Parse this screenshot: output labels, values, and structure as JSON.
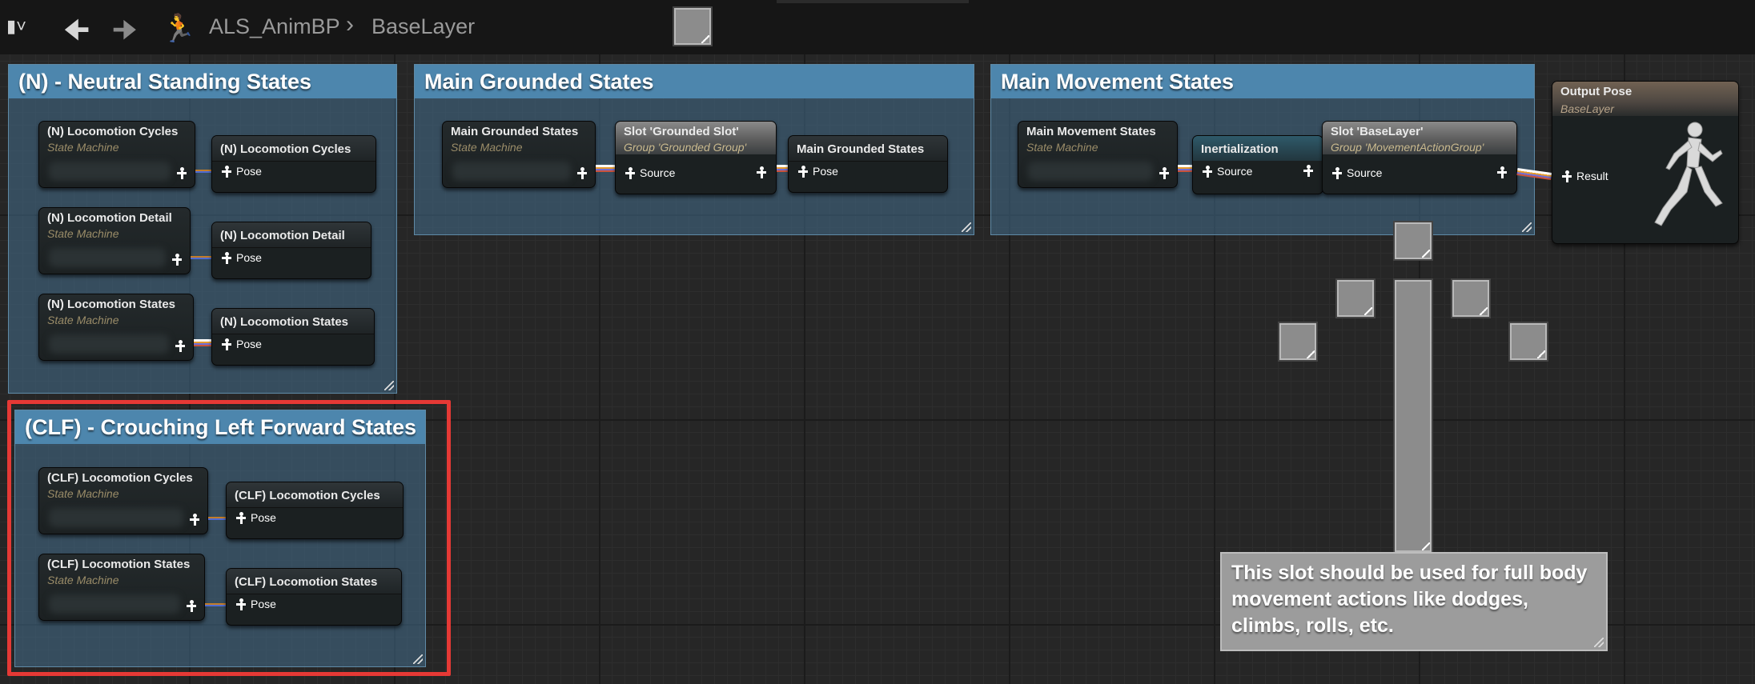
{
  "breadcrumb": {
    "graph": "ALS_AnimBP",
    "layer": "BaseLayer"
  },
  "icons": {
    "bookmark": "bookmark-icon",
    "back": "back-arrow-icon",
    "forward": "forward-arrow-icon",
    "anim": "running-man-icon"
  },
  "colors": {
    "comment": "#4d86ad",
    "highlight": "#e53935",
    "wire_exec": "#ffffff"
  },
  "comments": {
    "neutral": "(N) - Neutral Standing States",
    "grounded": "Main Grounded States",
    "movement": "Main Movement States",
    "crouch": "(CLF) - Crouching Left Forward States"
  },
  "labels": {
    "state_machine": "State Machine",
    "pose": "Pose",
    "source": "Source",
    "result": "Result"
  },
  "nodes": {
    "n_cycles": "(N) Locomotion Cycles",
    "n_detail": "(N) Locomotion Detail",
    "n_states": "(N) Locomotion States",
    "main_grounded": "Main Grounded States",
    "slot_grounded": "Slot 'Grounded Slot'",
    "slot_grounded_group": "Group 'Grounded Group'",
    "main_movement": "Main Movement States",
    "inertialization": "Inertialization",
    "slot_base": "Slot 'BaseLayer'",
    "slot_base_group": "Group 'MovementActionGroup'",
    "output_pose": "Output Pose",
    "output_sub": "BaseLayer",
    "clf_cycles": "(CLF) Locomotion Cycles",
    "clf_states": "(CLF) Locomotion States"
  },
  "note": "This slot should be used for full body movement actions like dodges, climbs, rolls, etc."
}
